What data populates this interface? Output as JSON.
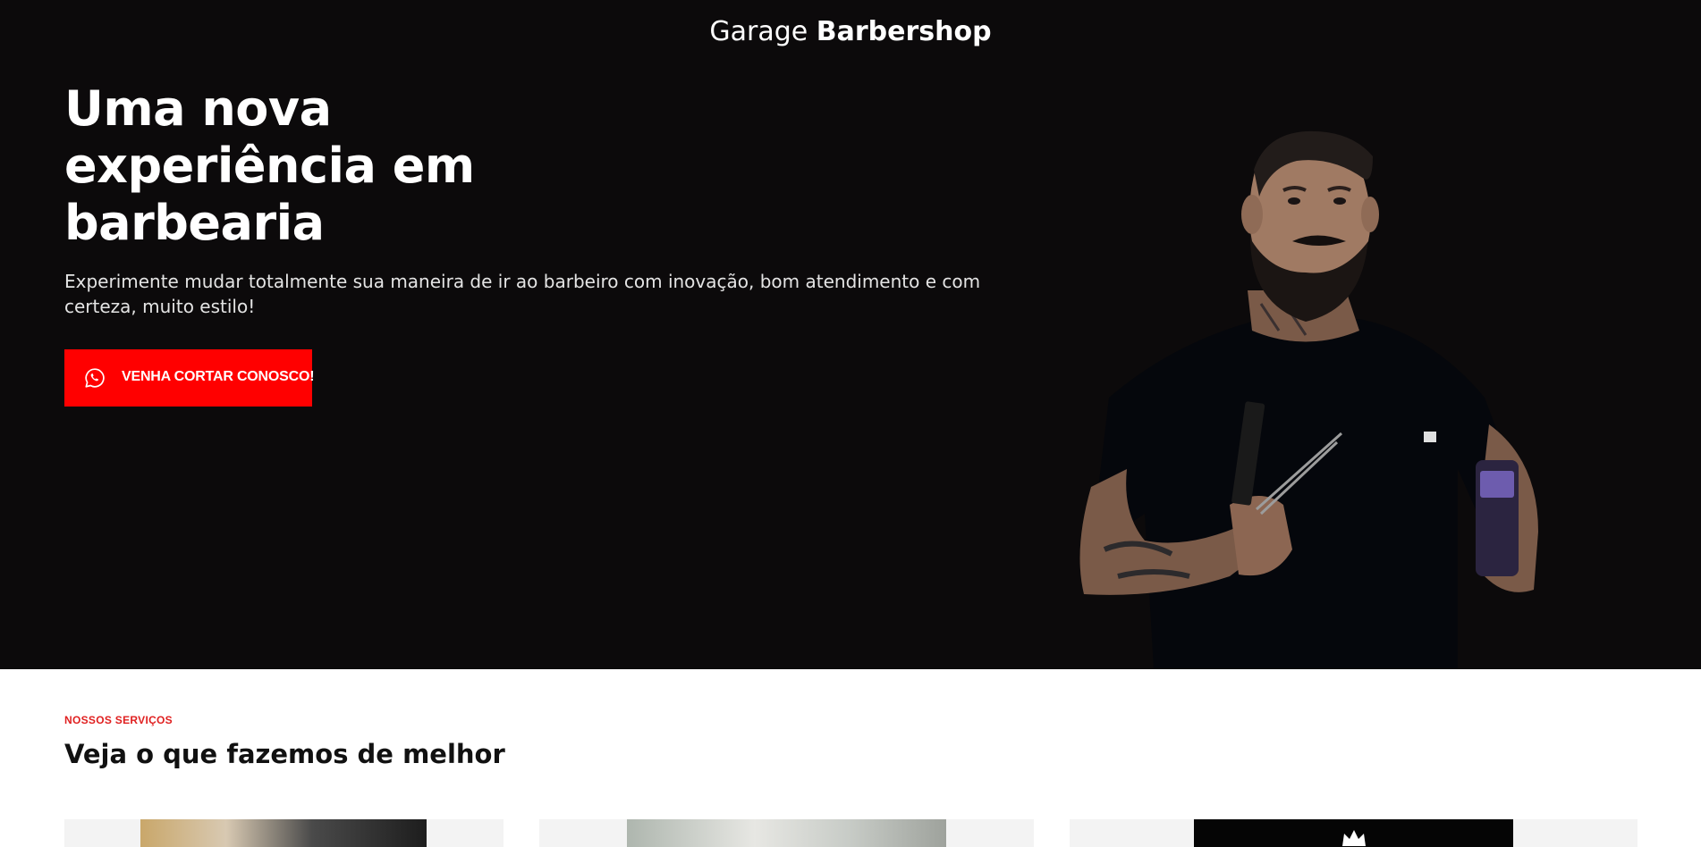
{
  "header": {
    "brand_light": "Garage",
    "brand_bold": "Barbershop"
  },
  "hero": {
    "headline": "Uma nova experiência em barbearia",
    "subtitle": "Experimente mudar totalmente sua maneira de ir ao barbeiro com inovação, bom atendimento e com certeza, muito estilo!",
    "cta_label": "VENHA CORTAR CONOSCO!",
    "cta_icon": "whatsapp-icon",
    "background_color": "#0c0a0b",
    "cta_color": "#ff0000"
  },
  "services": {
    "eyebrow": "NOSSOS SERVIÇOS",
    "title": "Veja o que fazemos de melhor",
    "eyebrow_color": "#e02020"
  }
}
